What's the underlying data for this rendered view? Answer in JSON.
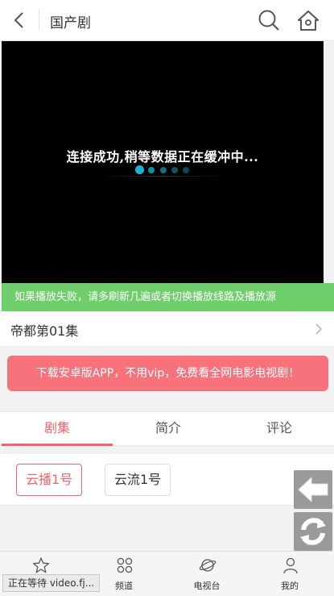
{
  "header": {
    "title": "国产剧"
  },
  "player": {
    "loading_text": "连接成功,稍等数据正在缓冲中..."
  },
  "notice": "如果播放失败，请多刷新几遍或者切换播放线路及播放源",
  "episode": {
    "title": "帝都第01集"
  },
  "banner": "下载安卓版APP，不用vip，免费看全网电影电视剧！",
  "tabs": [
    "剧集",
    "简介",
    "评论"
  ],
  "sources": [
    "云播1号",
    "云流1号"
  ],
  "bottom_nav": [
    {
      "label": "",
      "icon": "star-icon"
    },
    {
      "label": "频道",
      "icon": "channel-grid-icon"
    },
    {
      "label": "电视台",
      "icon": "planet-icon"
    },
    {
      "label": "我的",
      "icon": "user-icon"
    }
  ],
  "status_text": "正在等待 video.fj...",
  "colors": {
    "accent": "#f2646d",
    "notice_green": "#6fcf6b",
    "banner": "#f7727a",
    "player_dot": "#17b6d6"
  }
}
